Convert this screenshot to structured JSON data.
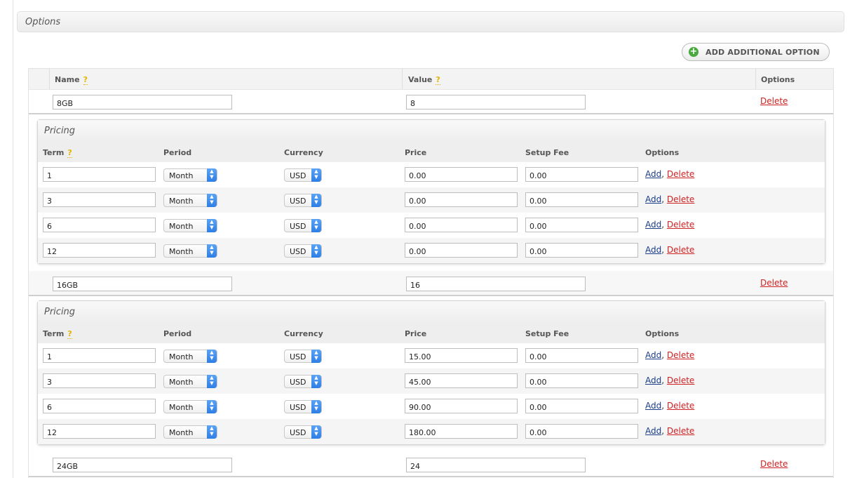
{
  "section": {
    "title": "Options"
  },
  "add_button": {
    "label": "ADD ADDITIONAL OPTION",
    "icon": "plus-circle-icon"
  },
  "table": {
    "headers": {
      "name": "Name",
      "value": "Value",
      "options": "Options"
    },
    "help_glyph": "?"
  },
  "pricing_headers": {
    "title": "Pricing",
    "term": "Term",
    "period": "Period",
    "currency": "Currency",
    "price": "Price",
    "setup_fee": "Setup Fee",
    "options": "Options"
  },
  "actions": {
    "add": "Add",
    "delete": "Delete",
    "separator": ", "
  },
  "options": [
    {
      "name": "8GB",
      "value": "8",
      "pricing": [
        {
          "term": "1",
          "period": "Month",
          "currency": "USD",
          "price": "0.00",
          "setup_fee": "0.00"
        },
        {
          "term": "3",
          "period": "Month",
          "currency": "USD",
          "price": "0.00",
          "setup_fee": "0.00"
        },
        {
          "term": "6",
          "period": "Month",
          "currency": "USD",
          "price": "0.00",
          "setup_fee": "0.00"
        },
        {
          "term": "12",
          "period": "Month",
          "currency": "USD",
          "price": "0.00",
          "setup_fee": "0.00"
        }
      ]
    },
    {
      "name": "16GB",
      "value": "16",
      "pricing": [
        {
          "term": "1",
          "period": "Month",
          "currency": "USD",
          "price": "15.00",
          "setup_fee": "0.00"
        },
        {
          "term": "3",
          "period": "Month",
          "currency": "USD",
          "price": "45.00",
          "setup_fee": "0.00"
        },
        {
          "term": "6",
          "period": "Month",
          "currency": "USD",
          "price": "90.00",
          "setup_fee": "0.00"
        },
        {
          "term": "12",
          "period": "Month",
          "currency": "USD",
          "price": "180.00",
          "setup_fee": "0.00"
        }
      ]
    },
    {
      "name": "24GB",
      "value": "24"
    }
  ],
  "colors": {
    "delete_link": "#cc2222",
    "add_link": "#1a3d86",
    "help": "#e4b400",
    "add_icon": "#4aa93f",
    "select_arrow": "#2d7ee6"
  }
}
